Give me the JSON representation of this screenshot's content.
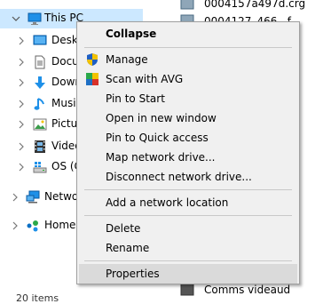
{
  "nav": {
    "items": [
      {
        "label": "This PC",
        "icon": "computer-icon",
        "chevron": "expanded"
      },
      {
        "label": "Desktop",
        "icon": "desktop-folder-icon",
        "chevron": "collapsed"
      },
      {
        "label": "Documents",
        "icon": "documents-folder-icon",
        "chevron": "collapsed"
      },
      {
        "label": "Downloads",
        "icon": "downloads-folder-icon",
        "chevron": "collapsed"
      },
      {
        "label": "Music",
        "icon": "music-folder-icon",
        "chevron": "collapsed"
      },
      {
        "label": "Pictures",
        "icon": "pictures-folder-icon",
        "chevron": "collapsed"
      },
      {
        "label": "Videos",
        "icon": "videos-folder-icon",
        "chevron": "collapsed"
      },
      {
        "label": "OS (C:)",
        "icon": "drive-icon",
        "chevron": "collapsed"
      },
      {
        "label": "Network",
        "icon": "network-icon",
        "chevron": "collapsed"
      },
      {
        "label": "Homegroup",
        "icon": "homegroup-icon",
        "chevron": "collapsed"
      }
    ],
    "status": "20 items"
  },
  "files": [
    {
      "name": "0004157a497d.crg"
    },
    {
      "name": "0004127_466...f"
    },
    {
      "name": "Comms videaud"
    }
  ],
  "menu": {
    "items": [
      {
        "label": "Collapse",
        "bold": true
      },
      {
        "label": "Manage",
        "icon": "shield-uac-icon"
      },
      {
        "label": "Scan with AVG",
        "icon": "avg-icon"
      },
      {
        "label": "Pin to Start"
      },
      {
        "label": "Open in new window"
      },
      {
        "label": "Pin to Quick access"
      },
      {
        "label": "Map network drive..."
      },
      {
        "label": "Disconnect network drive..."
      },
      {
        "label": "Add a network location"
      },
      {
        "label": "Delete"
      },
      {
        "label": "Rename"
      },
      {
        "label": "Properties",
        "hovered": true
      }
    ]
  },
  "colors": {
    "selection": "#cce8ff",
    "menu_bg": "#f0f0f0",
    "menu_hover": "#dadada",
    "folder_blue": "#1e90e8"
  }
}
